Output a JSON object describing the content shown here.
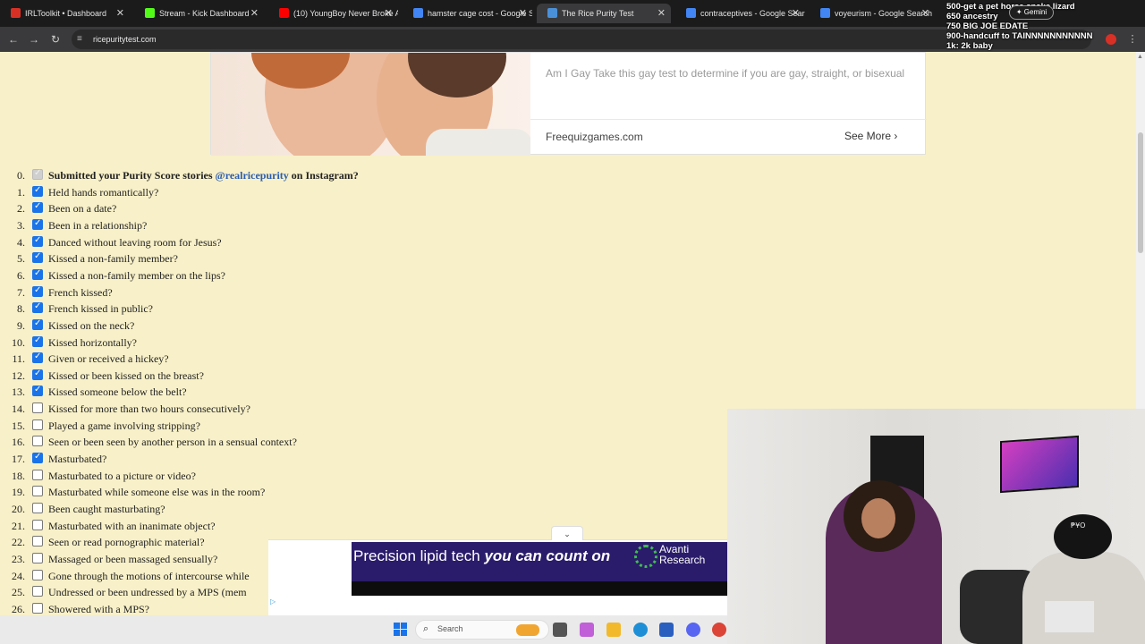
{
  "browser": {
    "tabs": [
      {
        "title": "IRLToolkit • Dashboard",
        "favicon_color": "#d93025",
        "active": false
      },
      {
        "title": "Stream - Kick Dashboard",
        "favicon_color": "#53fc18",
        "active": false
      },
      {
        "title": "(10) YoungBoy Never Broke A",
        "favicon_color": "#ff0000",
        "active": false
      },
      {
        "title": "hamster cage cost - Google S",
        "favicon_color": "#4285f4",
        "active": false
      },
      {
        "title": "The Rice Purity Test",
        "favicon_color": "#4a90d9",
        "active": true
      },
      {
        "title": "contraceptives - Google Sear",
        "favicon_color": "#4285f4",
        "active": false
      },
      {
        "title": "voyeurism - Google Search",
        "favicon_color": "#4285f4",
        "active": false
      }
    ],
    "url": "ricepuritytest.com",
    "gemini_label": "Gemini"
  },
  "stream_overlay": {
    "lines": [
      "500-get a pet horse,snake,lizard",
      "650 ancestry",
      "750 BIG JOE EDATE",
      "900-handcuff to TAINNNNNNNNNNN",
      "1k: 2k baby"
    ]
  },
  "ad": {
    "description": "Am I Gay Take this gay test to determine if you are gay, straight, or bisexual",
    "source": "Freequizgames.com",
    "see_more": "See More ›"
  },
  "questions": [
    {
      "num": "0.",
      "text": "Submitted your Purity Score stories ",
      "link": "@realricepurity",
      "after": " on Instagram?",
      "state": "disabled",
      "bold": true
    },
    {
      "num": "1.",
      "text": "Held hands romantically?",
      "state": "checked"
    },
    {
      "num": "2.",
      "text": "Been on a date?",
      "state": "checked"
    },
    {
      "num": "3.",
      "text": "Been in a relationship?",
      "state": "checked"
    },
    {
      "num": "4.",
      "text": "Danced without leaving room for Jesus?",
      "state": "checked"
    },
    {
      "num": "5.",
      "text": "Kissed a non-family member?",
      "state": "checked"
    },
    {
      "num": "6.",
      "text": "Kissed a non-family member on the lips?",
      "state": "checked"
    },
    {
      "num": "7.",
      "text": "French kissed?",
      "state": "checked"
    },
    {
      "num": "8.",
      "text": "French kissed in public?",
      "state": "checked"
    },
    {
      "num": "9.",
      "text": "Kissed on the neck?",
      "state": "checked"
    },
    {
      "num": "10.",
      "text": "Kissed horizontally?",
      "state": "checked"
    },
    {
      "num": "11.",
      "text": "Given or received a hickey?",
      "state": "checked"
    },
    {
      "num": "12.",
      "text": "Kissed or been kissed on the breast?",
      "state": "checked"
    },
    {
      "num": "13.",
      "text": "Kissed someone below the belt?",
      "state": "checked"
    },
    {
      "num": "14.",
      "text": "Kissed for more than two hours consecutively?",
      "state": "unchecked"
    },
    {
      "num": "15.",
      "text": "Played a game involving stripping?",
      "state": "unchecked"
    },
    {
      "num": "16.",
      "text": "Seen or been seen by another person in a sensual context?",
      "state": "unchecked"
    },
    {
      "num": "17.",
      "text": "Masturbated?",
      "state": "checked"
    },
    {
      "num": "18.",
      "text": "Masturbated to a picture or video?",
      "state": "unchecked"
    },
    {
      "num": "19.",
      "text": "Masturbated while someone else was in the room?",
      "state": "unchecked"
    },
    {
      "num": "20.",
      "text": "Been caught masturbating?",
      "state": "unchecked"
    },
    {
      "num": "21.",
      "text": "Masturbated with an inanimate object?",
      "state": "unchecked"
    },
    {
      "num": "22.",
      "text": "Seen or read pornographic material?",
      "state": "unchecked"
    },
    {
      "num": "23.",
      "text": "Massaged or been massaged sensually?",
      "state": "unchecked"
    },
    {
      "num": "24.",
      "text": "Gone through the motions of intercourse while",
      "state": "unchecked"
    },
    {
      "num": "25.",
      "text": "Undressed or been undressed by a MPS (mem",
      "state": "unchecked"
    },
    {
      "num": "26.",
      "text": "Showered with a MPS?",
      "state": "unchecked"
    }
  ],
  "bottom_ad": {
    "text_plain": "Precision lipid tech ",
    "text_em": "you can count on",
    "brand_line1": "Avanti",
    "brand_line2": "Research"
  },
  "webcam": {
    "cap_text": "₱¥O"
  },
  "taskbar": {
    "search_placeholder": "Search",
    "apps": [
      {
        "name": "file-icon",
        "color": "#555555"
      },
      {
        "name": "copilot-icon",
        "color": "#c05fd8"
      },
      {
        "name": "folder-icon",
        "color": "#f2b92c"
      },
      {
        "name": "edge-icon",
        "color": "#1e8fd6"
      },
      {
        "name": "store-icon",
        "color": "#2b5fbf"
      },
      {
        "name": "discord-icon",
        "color": "#5865f2"
      },
      {
        "name": "chrome-icon",
        "color": "#db4437"
      }
    ]
  }
}
